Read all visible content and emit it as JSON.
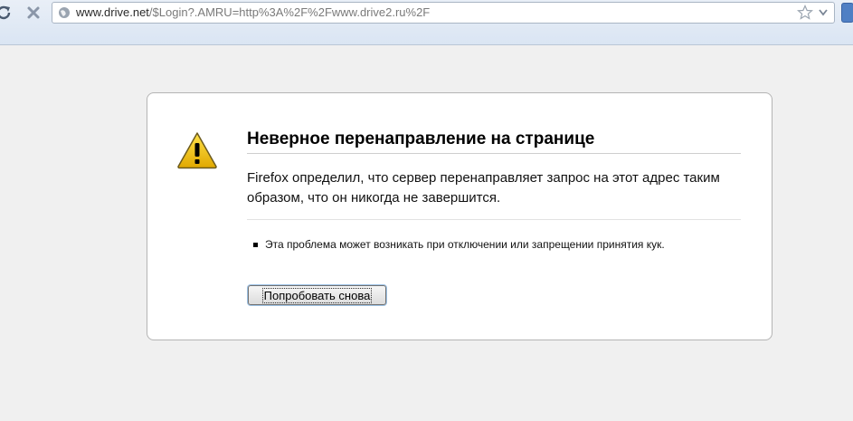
{
  "browser": {
    "url_host": "www.drive.net",
    "url_rest": "/$Login?.AMRU=http%3A%2F%2Fwww.drive2.ru%2F",
    "icons": [
      "reload-icon",
      "stop-icon",
      "globe-icon",
      "star-icon",
      "dropdown-icon"
    ]
  },
  "error": {
    "title": "Неверное перенаправление на странице",
    "description": "Firefox определил, что сервер перенаправляет запрос на этот адрес таким образом, что он никогда не завершится.",
    "bullet": "Эта проблема может возникать при отключении или запрещении принятия кук.",
    "retry_label": "Попробовать снова",
    "icon": "warning-icon"
  },
  "colors": {
    "toolbar_bg": "#dae5f3",
    "page_bg": "#f0f0f0",
    "warning_yellow": "#f2c200"
  }
}
